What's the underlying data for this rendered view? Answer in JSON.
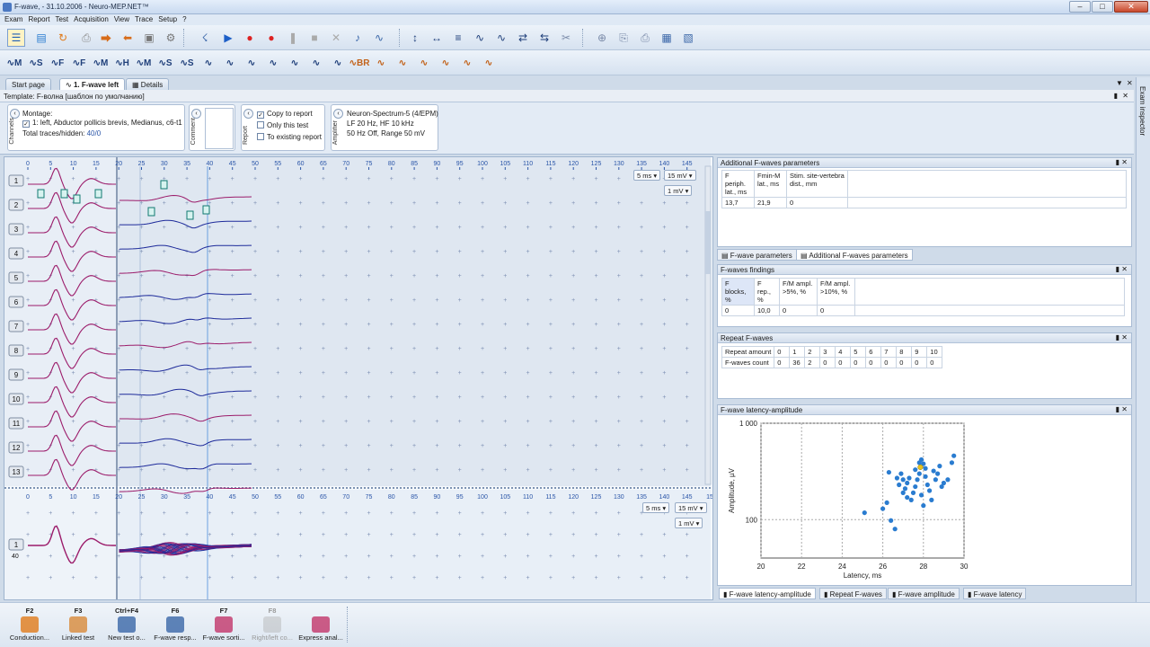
{
  "window": {
    "title": "F-wave, - 31.10.2006 - Neuro-MEP.NET™"
  },
  "menu": [
    "Exam",
    "Report",
    "Test",
    "Acquisition",
    "View",
    "Trace",
    "Setup",
    "?"
  ],
  "tabs": [
    "Start page",
    "1. F-wave left",
    "Details"
  ],
  "template": "Template: F-волна [шаблон по умолчанию]",
  "channels": {
    "label": "Channels",
    "montage_title": "Montage:",
    "montage_item": "1: left, Abductor pollicis brevis, Medianus, c6-t1",
    "total": "Total traces/hidden: ",
    "total_value": "40/0"
  },
  "comment": {
    "label": "Comment"
  },
  "report": {
    "label": "Report",
    "copy": "Copy to report",
    "only": "Only this test",
    "existing": "To existing report"
  },
  "amplifier": {
    "label": "Amplifier",
    "device": "Neuron-Spectrum-5 (4/EPM)",
    "filters": "LF  20 Hz, HF  10 kHz",
    "notch": "50 Hz  Off, Range  50 mV"
  },
  "sweep": {
    "axis_ticks": [
      "0",
      "5",
      "10",
      "15",
      "20",
      "25",
      "30",
      "35",
      "40",
      "45",
      "50",
      "55",
      "60",
      "65",
      "70",
      "75",
      "80",
      "85",
      "90",
      "95",
      "100",
      "105",
      "110",
      "115",
      "120",
      "125",
      "130",
      "135",
      "140",
      "145"
    ],
    "time_base": "5 ms",
    "sens1": "15 mV",
    "sens2": "1 mV",
    "trace_numbers": [
      "1",
      "2",
      "3",
      "4",
      "5",
      "6",
      "7",
      "8",
      "9",
      "10",
      "11",
      "12",
      "13"
    ]
  },
  "superimposed": {
    "axis_ticks": [
      "0",
      "5",
      "10",
      "15",
      "20",
      "25",
      "30",
      "35",
      "40",
      "45",
      "50",
      "55",
      "60",
      "65",
      "70",
      "75",
      "80",
      "85",
      "90",
      "95",
      "100",
      "105",
      "110",
      "115",
      "120",
      "125",
      "130",
      "135",
      "140",
      "145",
      "15"
    ],
    "time_base": "5 ms",
    "sens1": "15 mV",
    "sens2": "1 mV",
    "trace_number": "1",
    "trace_count": "40"
  },
  "additional_params": {
    "title": "Additional F-waves parameters",
    "headers": [
      "F periph. lat., ms",
      "Fmin-M lat., ms",
      "Stim. site-vertebra dist., mm"
    ],
    "values": [
      "13,7",
      "21,9",
      "0"
    ]
  },
  "param_tabs": [
    "F-wave parameters",
    "Additional F-waves parameters"
  ],
  "findings": {
    "title": "F-waves findings",
    "headers": [
      "F blocks, %",
      "F rep., %",
      "F/M ampl. >5%, %",
      "F/M ampl. >10%, %"
    ],
    "values": [
      "0",
      "10,0",
      "0",
      "0"
    ]
  },
  "repeat": {
    "title": "Repeat F-waves",
    "row1_label": "Repeat amount",
    "row2_label": "F-waves count",
    "amounts": [
      "0",
      "1",
      "2",
      "3",
      "4",
      "5",
      "6",
      "7",
      "8",
      "9",
      "10"
    ],
    "counts": [
      "0",
      "36",
      "2",
      "0",
      "0",
      "0",
      "0",
      "0",
      "0",
      "0",
      "0"
    ]
  },
  "scatter": {
    "title": "F-wave latency-amplitude",
    "xlabel": "Latency, ms",
    "ylabel": "Amplitude, µV",
    "x_ticks": [
      "20",
      "22",
      "24",
      "26",
      "28",
      "30"
    ],
    "y_ticks": [
      "1 000",
      "100"
    ]
  },
  "chart_data": {
    "type": "scatter",
    "title": "F-wave latency-amplitude",
    "xlabel": "Latency, ms",
    "ylabel": "Amplitude, µV",
    "xlim": [
      20,
      30
    ],
    "ylim": [
      40,
      1000
    ],
    "yscale": "log",
    "series": [
      {
        "points": [
          [
            25.1,
            118
          ],
          [
            26.0,
            130
          ],
          [
            26.4,
            98
          ],
          [
            26.6,
            80
          ],
          [
            26.3,
            310
          ],
          [
            26.7,
            270
          ],
          [
            26.8,
            230
          ],
          [
            26.9,
            300
          ],
          [
            27.0,
            260
          ],
          [
            27.0,
            190
          ],
          [
            27.1,
            210
          ],
          [
            27.2,
            240
          ],
          [
            27.3,
            270
          ],
          [
            27.4,
            160
          ],
          [
            27.5,
            190
          ],
          [
            27.6,
            220
          ],
          [
            27.6,
            330
          ],
          [
            27.7,
            260
          ],
          [
            27.8,
            300
          ],
          [
            27.8,
            390
          ],
          [
            27.9,
            420
          ],
          [
            28.0,
            380
          ],
          [
            28.0,
            140
          ],
          [
            28.1,
            340
          ],
          [
            28.1,
            280
          ],
          [
            28.2,
            230
          ],
          [
            28.3,
            200
          ],
          [
            28.4,
            160
          ],
          [
            28.5,
            320
          ],
          [
            28.6,
            260
          ],
          [
            28.7,
            300
          ],
          [
            28.8,
            360
          ],
          [
            28.9,
            220
          ],
          [
            29.0,
            240
          ],
          [
            29.2,
            260
          ],
          [
            29.4,
            390
          ],
          [
            29.5,
            460
          ],
          [
            26.2,
            150
          ],
          [
            27.2,
            170
          ],
          [
            27.9,
            180
          ]
        ]
      }
    ],
    "highlight": [
      [
        27.85,
        350
      ]
    ]
  },
  "bottom_tabs": [
    "F-wave latency-amplitude",
    "Repeat F-waves",
    "F-wave amplitude",
    "F-wave latency"
  ],
  "inspector": "Exam inspector",
  "fkeys": [
    {
      "key": "F2",
      "label": "Conduction..."
    },
    {
      "key": "F3",
      "label": "Linked test"
    },
    {
      "key": "Ctrl+F4",
      "label": "New test o..."
    },
    {
      "key": "F6",
      "label": "F-wave resp..."
    },
    {
      "key": "F7",
      "label": "F-wave sorti..."
    },
    {
      "key": "F8",
      "label": "Right/left co..."
    },
    {
      "key": "",
      "label": "Express anal..."
    }
  ],
  "colors": {
    "trace_magenta": "#9b1b6a",
    "trace_blue": "#1d2a9a",
    "scatter_point": "#2a7cd0",
    "highlight_point": "#e9c21a"
  }
}
